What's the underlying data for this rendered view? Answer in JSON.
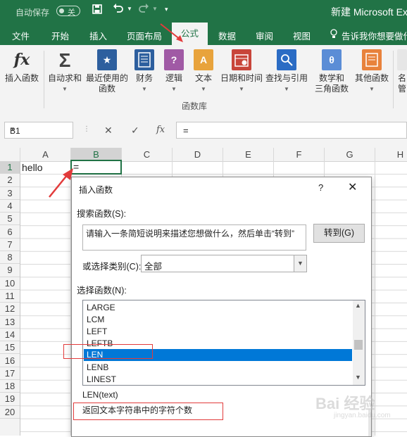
{
  "titlebar": {
    "autosave_label": "自动保存",
    "autosave_state": "关",
    "window_title": "新建 Microsoft Exc"
  },
  "tabs": [
    "文件",
    "开始",
    "插入",
    "页面布局",
    "公式",
    "数据",
    "审阅",
    "视图"
  ],
  "active_tab": "公式",
  "tell_me": "告诉我你想要做什",
  "ribbon": {
    "insert_function": "插入函数",
    "autosum": "自动求和",
    "recent": [
      "最近使用的",
      "函数"
    ],
    "financial": "财务",
    "logical": "逻辑",
    "text": "文本",
    "datetime": "日期和时间",
    "lookup": "查找与引用",
    "math": [
      "数学和",
      "三角函数"
    ],
    "more": "其他函数",
    "cut_label_1": "名",
    "cut_label_2": "管",
    "group_label": "函数库",
    "icon_glyphs": {
      "fx": "fx",
      "sigma": "Σ",
      "financial": "?",
      "logical": "A",
      "text": "θ"
    }
  },
  "formula_bar": {
    "name_box": "B1",
    "cancel": "✕",
    "enter": "✓",
    "fx": "fx",
    "content": "="
  },
  "columns": [
    "A",
    "B",
    "C",
    "D",
    "E",
    "F",
    "G",
    "H"
  ],
  "selected_column": "B",
  "rows": [
    "1",
    "2",
    "3",
    "4",
    "5",
    "6",
    "7",
    "8",
    "9",
    "10",
    "11",
    "12",
    "13",
    "14",
    "15",
    "16",
    "17",
    "18",
    "19",
    "20"
  ],
  "cells": {
    "A1": "hello",
    "B1": "="
  },
  "dialog": {
    "title": "插入函数",
    "help": "?",
    "close": "✕",
    "search_label": "搜索函数(S):",
    "search_text": "请输入一条简短说明来描述您想做什么，然后单击“转到”",
    "go_button": "转到(G)",
    "category_label": "或选择类别(C):",
    "category_value": "全部",
    "select_label": "选择函数(N):",
    "functions": [
      "LARGE",
      "LCM",
      "LEFT",
      "LEFTB",
      "LEN",
      "LENB",
      "LINEST"
    ],
    "selected_function": "LEN",
    "signature": "LEN(text)",
    "description": "返回文本字符串中的字符个数"
  },
  "watermark": {
    "main": "Bai 经验",
    "sub": "jingyan.baidu.com"
  },
  "colors": {
    "excel_green": "#217346",
    "selection_blue": "#0078d7",
    "annotation_red": "#e23b3b"
  }
}
